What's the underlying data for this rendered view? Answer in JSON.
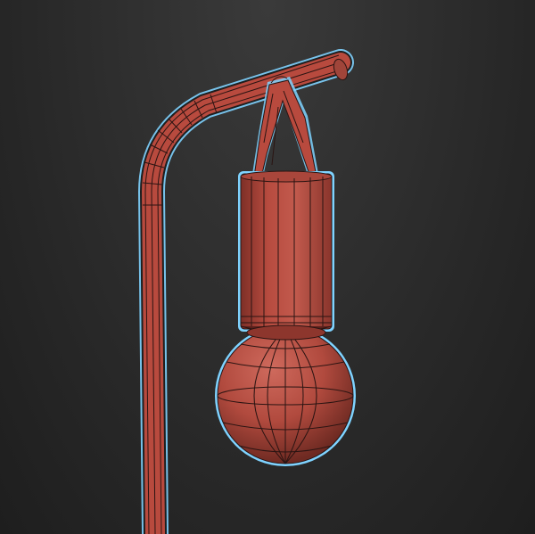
{
  "viewport": {
    "background": "#2c2c2c",
    "mesh_color": "#b84a3e",
    "wire_color": "#2a1412",
    "outline_color": "#7fd3ff"
  },
  "objects": [
    {
      "name": "lamp-pole",
      "kind": "bent-tube"
    },
    {
      "name": "bulb-socket",
      "kind": "cylinder"
    },
    {
      "name": "bulb",
      "kind": "sphere"
    },
    {
      "name": "hanger-clip",
      "kind": "clip"
    }
  ]
}
